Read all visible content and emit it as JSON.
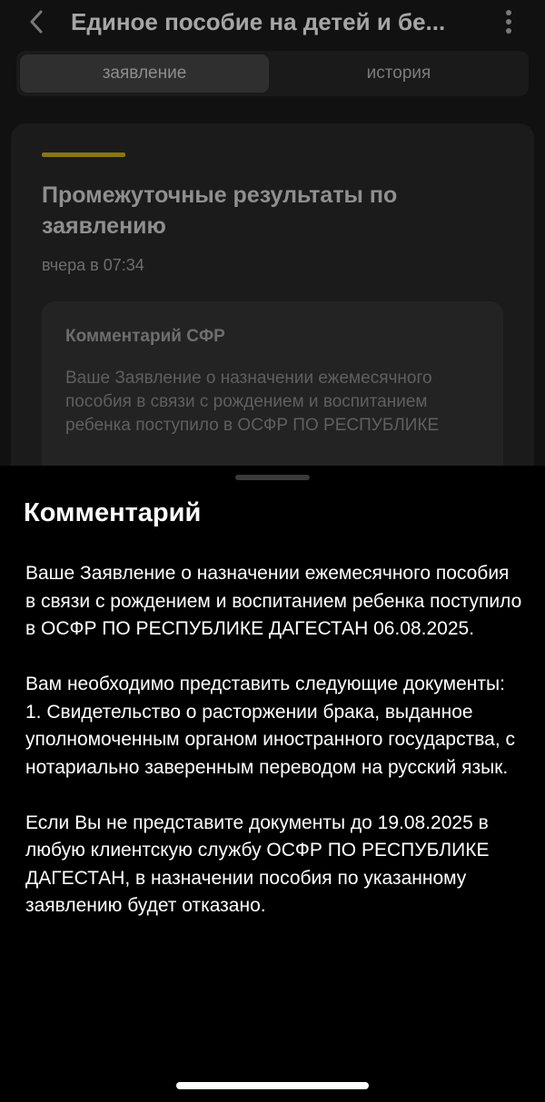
{
  "header": {
    "back_icon": "chevron-left-icon",
    "title": "Единое пособие на детей и бе...",
    "menu_icon": "vertical-ellipsis-icon"
  },
  "tabs": [
    {
      "label": "заявление",
      "active": true
    },
    {
      "label": "история",
      "active": false
    }
  ],
  "card": {
    "accent_color": "#8a7414",
    "title": "Промежуточные результаты по заявлению",
    "time": "вчера в 07:34",
    "comment": {
      "title": "Комментарий СФР",
      "text": "Ваше Заявление о назначении ежемесячного пособия в связи с рождением и воспитанием ребенка поступило в ОСФР ПО РЕСПУБЛИКЕ"
    }
  },
  "sheet": {
    "title": "Комментарий",
    "paragraph_1": "Ваше Заявление о назначении ежемесячного пособия в связи с рождением и воспитанием ребенка поступило в ОСФР ПО РЕСПУБЛИКЕ ДАГЕСТАН 06.08.2025.",
    "paragraph_2_intro": "Вам необходимо представить следующие документы:",
    "paragraph_2_item": "1. Свидетельство о расторжении брака, выданное уполномоченным органом иностранного государства, с нотариально заверенным переводом на русский язык.",
    "paragraph_3": "Если Вы не представите документы до 19.08.2025 в любую клиентскую службу ОСФР ПО РЕСПУБЛИКЕ ДАГЕСТАН, в назначении пособия по указанному заявлению будет отказано."
  }
}
